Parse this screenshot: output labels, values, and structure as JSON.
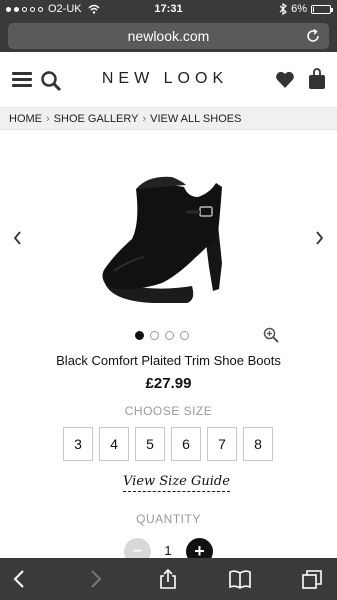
{
  "status_bar": {
    "carrier": "O2-UK",
    "time": "17:31",
    "battery": "6%",
    "battery_level": 0.06,
    "signal_dots_filled": 2,
    "signal_dots_total": 5
  },
  "browser": {
    "url": "newlook.com"
  },
  "header": {
    "logo": "NEW LOOK",
    "icons": [
      "menu-icon",
      "search-icon",
      "heart-icon",
      "bag-icon"
    ]
  },
  "breadcrumb": [
    "HOME",
    "SHOE GALLERY",
    "VIEW ALL SHOES"
  ],
  "product": {
    "title": "Black Comfort Plaited Trim Shoe Boots",
    "price": "£27.99",
    "image_count": 4,
    "current_image": 1
  },
  "size_section": {
    "label": "CHOOSE SIZE",
    "sizes": [
      "3",
      "4",
      "5",
      "6",
      "7",
      "8"
    ],
    "guide_link": "View Size Guide"
  },
  "quantity": {
    "label": "QUANTITY",
    "value": "1",
    "minus": "−",
    "plus": "+"
  },
  "toolbar": {
    "icons": [
      "back-icon",
      "forward-icon",
      "share-icon",
      "bookmarks-icon",
      "tabs-icon"
    ]
  },
  "colors": {
    "chrome": "#3a3a3c",
    "breadcrumb_bg": "#f0f0f0",
    "accent": "#111111"
  }
}
